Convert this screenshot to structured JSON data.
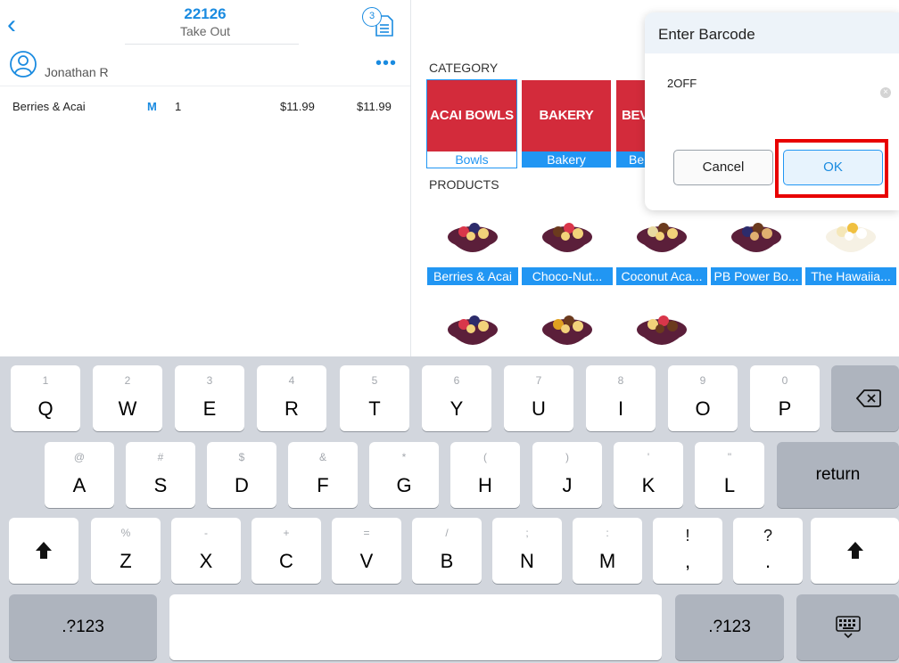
{
  "order": {
    "number": "22126",
    "type": "Take Out",
    "ticket_count": "3",
    "customer": "Jonathan R",
    "items": [
      {
        "name": "Berries & Acai",
        "modifier": "M",
        "qty": "1",
        "price": "$11.99",
        "total": "$11.99"
      }
    ]
  },
  "catalog": {
    "category_heading": "CATEGORY",
    "products_heading": "PRODUCTS",
    "categories": [
      {
        "image_text": "ACAI BOWLS",
        "label": "Bowls"
      },
      {
        "image_text": "BAKERY",
        "label": "Bakery"
      },
      {
        "image_text": "BEV",
        "label": "Be"
      }
    ],
    "products": [
      {
        "label": "Berries & Acai"
      },
      {
        "label": "Choco-Nut..."
      },
      {
        "label": "Coconut Aca..."
      },
      {
        "label": "PB Power Bo..."
      },
      {
        "label": "The Hawaiia..."
      },
      {
        "label": ""
      },
      {
        "label": ""
      },
      {
        "label": ""
      }
    ]
  },
  "dialog": {
    "title": "Enter Barcode",
    "input_value": "2OFF",
    "cancel_label": "Cancel",
    "ok_label": "OK"
  },
  "keyboard": {
    "row1": [
      {
        "hint": "1",
        "main": "Q"
      },
      {
        "hint": "2",
        "main": "W"
      },
      {
        "hint": "3",
        "main": "E"
      },
      {
        "hint": "4",
        "main": "R"
      },
      {
        "hint": "5",
        "main": "T"
      },
      {
        "hint": "6",
        "main": "Y"
      },
      {
        "hint": "7",
        "main": "U"
      },
      {
        "hint": "8",
        "main": "I"
      },
      {
        "hint": "9",
        "main": "O"
      },
      {
        "hint": "0",
        "main": "P"
      }
    ],
    "row2": [
      {
        "hint": "@",
        "main": "A"
      },
      {
        "hint": "#",
        "main": "S"
      },
      {
        "hint": "$",
        "main": "D"
      },
      {
        "hint": "&",
        "main": "F"
      },
      {
        "hint": "*",
        "main": "G"
      },
      {
        "hint": "(",
        "main": "H"
      },
      {
        "hint": ")",
        "main": "J"
      },
      {
        "hint": "'",
        "main": "K"
      },
      {
        "hint": "\"",
        "main": "L"
      }
    ],
    "row3": [
      {
        "hint": "%",
        "main": "Z"
      },
      {
        "hint": "-",
        "main": "X"
      },
      {
        "hint": "+",
        "main": "C"
      },
      {
        "hint": "=",
        "main": "V"
      },
      {
        "hint": "/",
        "main": "B"
      },
      {
        "hint": ";",
        "main": "N"
      },
      {
        "hint": ":",
        "main": "M"
      },
      {
        "hint": "!",
        "main": ","
      },
      {
        "hint": "?",
        "main": "."
      }
    ],
    "return_label": "return",
    "numbers_label": ".?123"
  }
}
